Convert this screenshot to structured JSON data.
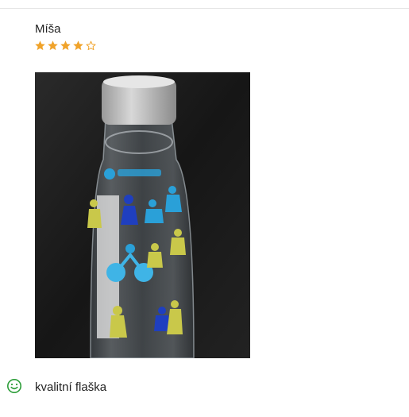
{
  "review": {
    "reviewer_name": "Míša",
    "rating": {
      "value": 4,
      "max": 5
    },
    "photo": {
      "alt": "Photo of the bottle",
      "icon": "bottle-photo"
    },
    "pros": [
      {
        "icon": "smile-icon",
        "text": "kvalitní flaška"
      }
    ]
  },
  "colors": {
    "star_filled": "#f0a32a",
    "star_empty": "#f0a32a",
    "positive": "#2e9e3a",
    "divider": "#e3e3e3"
  }
}
